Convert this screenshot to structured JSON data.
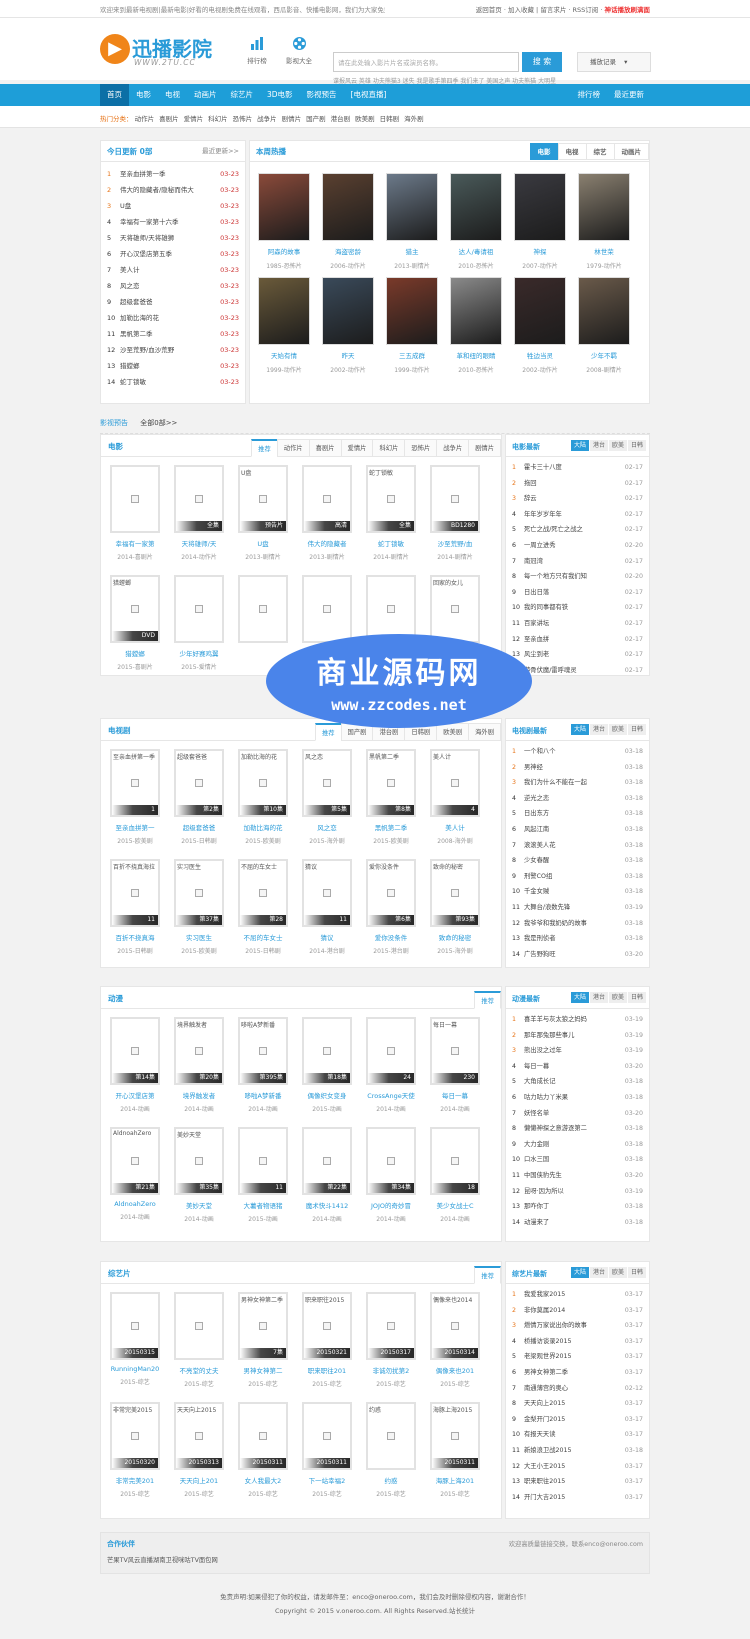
{
  "topbar": {
    "text": "欢迎来到最新电视剧|最新电影|好看的电视剧免费在线观看，西瓜影音、快播电影网，我们为大家免费提供好看的电影",
    "links": [
      "返回首页",
      "加入收藏",
      "留言求片",
      "RSS订阅"
    ],
    "hot": "神话播放刷满面"
  },
  "header": {
    "logo_name": "迅播影院",
    "logo_domain": "WWW.2TU.CC",
    "icons": [
      {
        "label": "排行榜",
        "icon": "bar-chart-icon"
      },
      {
        "label": "影视大全",
        "icon": "film-reel-icon"
      }
    ],
    "search_placeholder": "请在此处输入影片片名或演员名称。",
    "search_button": "搜 索",
    "hotwords": "谍报风云  英雄  功夫熊猫3  迷失  我是歌手第四季  我们来了  美国之声  功夫熊猫  大明星",
    "history": "播放记录"
  },
  "nav": {
    "items": [
      "首页",
      "电影",
      "电视",
      "动画片",
      "综艺片",
      "3D电影",
      "影视预告",
      "[电视直播]"
    ],
    "right": [
      "排行榜",
      "最近更新"
    ]
  },
  "subnav": {
    "label": "热门分类：",
    "items": [
      "动作片",
      "喜剧片",
      "爱情片",
      "科幻片",
      "恐怖片",
      "战争片",
      "剧情片",
      "国产剧",
      "港台剧",
      "欧美剧",
      "日韩剧",
      "海外剧"
    ]
  },
  "today": {
    "title": "今日更新 0部",
    "more": "最近更新>>",
    "items": [
      {
        "n": "1",
        "t": "至亲血拼第一季",
        "d": "03-23"
      },
      {
        "n": "2",
        "t": "伟大的隐藏者/隐秘而伟大",
        "d": "03-23"
      },
      {
        "n": "3",
        "t": "U盘",
        "d": "03-23"
      },
      {
        "n": "4",
        "t": "幸福有一家第十六季",
        "d": "03-23"
      },
      {
        "n": "5",
        "t": "天将雄师/天将雄狮",
        "d": "03-23"
      },
      {
        "n": "6",
        "t": "开心汉堡店第五季",
        "d": "03-23"
      },
      {
        "n": "7",
        "t": "美人计",
        "d": "03-23"
      },
      {
        "n": "8",
        "t": "风之恋",
        "d": "03-23"
      },
      {
        "n": "9",
        "t": "超级套爸爸",
        "d": "03-23"
      },
      {
        "n": "10",
        "t": "加勒比海的花",
        "d": "03-23"
      },
      {
        "n": "11",
        "t": "黑帆第二季",
        "d": "03-23"
      },
      {
        "n": "12",
        "t": "沙至荒野/血沙荒野",
        "d": "03-23"
      },
      {
        "n": "13",
        "t": "猎螳螂",
        "d": "03-23"
      },
      {
        "n": "14",
        "t": "蛇丁锁敏",
        "d": "03-23"
      }
    ]
  },
  "hotweek": {
    "title": "本周热播",
    "tabs": [
      "电影",
      "电视",
      "综艺",
      "动画片"
    ],
    "row1": [
      {
        "nm": "阿森的故事",
        "sb": "1985-恐怖片",
        "c": "#8a4a3a"
      },
      {
        "nm": "海盗密龄",
        "sb": "2006-动作片",
        "c": "#5a4030"
      },
      {
        "nm": "猎主",
        "sb": "2013-剧情片",
        "c": "#6c7a8a"
      },
      {
        "nm": "达人/毒请祖",
        "sb": "2010-恐怖片",
        "c": "#4a5a5a"
      },
      {
        "nm": "神探",
        "sb": "2007-动作片",
        "c": "#3a3a40"
      },
      {
        "nm": "林世荣",
        "sb": "1979-动作片",
        "c": "#8a8070"
      }
    ],
    "row2": [
      {
        "nm": "天始有情",
        "sb": "1999-动作片",
        "c": "#6a5a3a"
      },
      {
        "nm": "昨天",
        "sb": "2002-动作片",
        "c": "#3a4a5a"
      },
      {
        "nm": "三五成群",
        "sb": "1999-动作片",
        "c": "#7a3a2a"
      },
      {
        "nm": "革和纽的眼睛",
        "sb": "2010-恐怖片",
        "c": "#8a8a8a"
      },
      {
        "nm": "牲边当灵",
        "sb": "2002-动作片",
        "c": "#3a2a2a"
      },
      {
        "nm": "少年不羁",
        "sb": "2008-剧情片",
        "c": "#6a5a4a"
      }
    ]
  },
  "preview": {
    "title": "影视预告",
    "all": "全部0部>>"
  },
  "movies": {
    "title": "电影",
    "tabs": [
      "推荐",
      "动作片",
      "喜剧片",
      "爱情片",
      "科幻片",
      "恐怖片",
      "战争片",
      "剧情片"
    ],
    "row1": [
      {
        "cap": "",
        "bar": "",
        "nm": "幸福有一家第",
        "sb": "2014-喜剧片"
      },
      {
        "cap": "",
        "bar": "全集",
        "nm": "天将雄师/天",
        "sb": "2014-动作片"
      },
      {
        "cap": "U盘",
        "bar": "预告片",
        "nm": "U盘",
        "sb": "2013-剧情片"
      },
      {
        "cap": "",
        "bar": "高清",
        "nm": "伟大的隐藏者",
        "sb": "2013-剧情片"
      },
      {
        "cap": "蛇丁锁敏",
        "bar": "全集",
        "nm": "蛇丁锁敏",
        "sb": "2014-剧情片"
      },
      {
        "cap": "",
        "bar": "BD1280",
        "nm": "沙至荒野/血",
        "sb": "2014-剧情片"
      }
    ],
    "row2": [
      {
        "cap": "猎螳螂",
        "bar": "DVD",
        "nm": "猎螳螂",
        "sb": "2015-喜剧片"
      },
      {
        "cap": "",
        "bar": "",
        "nm": "少年好赛鸡翼",
        "sb": "2015-爱情片"
      },
      {
        "cap": "",
        "bar": "",
        "nm": "",
        "sb": ""
      },
      {
        "cap": "",
        "bar": "",
        "nm": "",
        "sb": ""
      },
      {
        "cap": "",
        "bar": "",
        "nm": "",
        "sb": ""
      },
      {
        "cap": "回家的女儿",
        "bar": "",
        "nm": "",
        "sb": ""
      }
    ]
  },
  "movie_rank": {
    "title": "电影最新",
    "tabs": [
      "大陆",
      "港台",
      "欧美",
      "日韩"
    ],
    "items": [
      {
        "n": "1",
        "t": "霍卡三十八度",
        "d": "02-17"
      },
      {
        "n": "2",
        "t": "拖回",
        "d": "02-17"
      },
      {
        "n": "3",
        "t": "辞云",
        "d": "02-17"
      },
      {
        "n": "4",
        "t": "年年岁岁年年",
        "d": "02-17"
      },
      {
        "n": "5",
        "t": "死亡之战/死亡之战之",
        "d": "02-17"
      },
      {
        "n": "6",
        "t": "一周立进秀",
        "d": "02-20"
      },
      {
        "n": "7",
        "t": "南冠湾",
        "d": "02-17"
      },
      {
        "n": "8",
        "t": "每一个地方只有我们知",
        "d": "02-20"
      },
      {
        "n": "9",
        "t": "日出日落",
        "d": "02-17"
      },
      {
        "n": "10",
        "t": "我的同事都有铁",
        "d": "02-17"
      },
      {
        "n": "11",
        "t": "百家讲坛",
        "d": "02-17"
      },
      {
        "n": "12",
        "t": "至亲血拼",
        "d": "02-17"
      },
      {
        "n": "13",
        "t": "风尘到老",
        "d": "02-17"
      },
      {
        "n": "14",
        "t": "游骨伏魔/雷呼魂灵",
        "d": "02-17"
      }
    ]
  },
  "tv": {
    "title": "电视剧",
    "tabs": [
      "推荐",
      "国产剧",
      "港台剧",
      "日韩剧",
      "欧美剧",
      "海外剧"
    ],
    "row1": [
      {
        "cap": "至亲血拼第一季",
        "bar": "1",
        "nm": "至亲血拼第一",
        "sb": "2015-欧美剧"
      },
      {
        "cap": "超级套爸爸",
        "bar": "第2集",
        "nm": "超级套爸爸",
        "sb": "2015-日韩剧"
      },
      {
        "cap": "加勒比海的花",
        "bar": "第10集",
        "nm": "加勒比海的花",
        "sb": "2015-欧美剧"
      },
      {
        "cap": "风之恋",
        "bar": "第5集",
        "nm": "风之恋",
        "sb": "2015-海外剧"
      },
      {
        "cap": "黑帆第二季",
        "bar": "第8集",
        "nm": "黑帆第二季",
        "sb": "2015-欧美剧"
      },
      {
        "cap": "美人计",
        "bar": "4",
        "nm": "美人计",
        "sb": "2008-海外剧"
      }
    ],
    "row2": [
      {
        "cap": "百折不挠真海拉",
        "bar": "11",
        "nm": "百折不挠真海",
        "sb": "2015-日韩剧"
      },
      {
        "cap": "实习医生",
        "bar": "第37集",
        "nm": "实习医生",
        "sb": "2015-欧美剧"
      },
      {
        "cap": "不屈的车女士",
        "bar": "第28",
        "nm": "不屈的车女士",
        "sb": "2015-日韩剧"
      },
      {
        "cap": "猜议",
        "bar": "11",
        "nm": "猜议",
        "sb": "2014-港台剧"
      },
      {
        "cap": "爱你没条件",
        "bar": "第6集",
        "nm": "爱你没条件",
        "sb": "2015-港台剧"
      },
      {
        "cap": "致命的秘密",
        "bar": "第93集",
        "nm": "致命的秘密",
        "sb": "2015-海外剧"
      }
    ]
  },
  "tv_rank": {
    "title": "电视剧最新",
    "tabs": [
      "大陆",
      "港台",
      "欧美",
      "日韩"
    ],
    "items": [
      {
        "n": "1",
        "t": "一个和八个",
        "d": "03-18"
      },
      {
        "n": "2",
        "t": "男神经",
        "d": "03-18"
      },
      {
        "n": "3",
        "t": "我们为什么不能在一起",
        "d": "03-18"
      },
      {
        "n": "4",
        "t": "逆光之恋",
        "d": "03-18"
      },
      {
        "n": "5",
        "t": "日出东方",
        "d": "03-18"
      },
      {
        "n": "6",
        "t": "风起江南",
        "d": "03-18"
      },
      {
        "n": "7",
        "t": "滚滚美人花",
        "d": "03-18"
      },
      {
        "n": "8",
        "t": "少女春醒",
        "d": "03-18"
      },
      {
        "n": "9",
        "t": "刑警CO组",
        "d": "03-18"
      },
      {
        "n": "10",
        "t": "千金女贼",
        "d": "03-18"
      },
      {
        "n": "11",
        "t": "大舞台/浪数先锋",
        "d": "03-19"
      },
      {
        "n": "12",
        "t": "我爷爷和我奶奶的故事",
        "d": "03-18"
      },
      {
        "n": "13",
        "t": "我是刑侦者",
        "d": "03-18"
      },
      {
        "n": "14",
        "t": "广告野狗旺",
        "d": "03-20"
      }
    ]
  },
  "anime": {
    "title": "动漫",
    "tabs": [
      "推荐"
    ],
    "row1": [
      {
        "cap": "",
        "bar": "第14集",
        "nm": "开心汉堡店第",
        "sb": "2014-动画"
      },
      {
        "cap": "境界触发者",
        "bar": "第20集",
        "nm": "境界触发者",
        "sb": "2014-动画"
      },
      {
        "cap": "哆啦A梦新番",
        "bar": "第395集",
        "nm": "哆啦A梦新番",
        "sb": "2014-动画"
      },
      {
        "cap": "",
        "bar": "第18集",
        "nm": "偶像织女变身",
        "sb": "2015-动画"
      },
      {
        "cap": "",
        "bar": "24",
        "nm": "CrossAnge天使",
        "sb": "2014-动画"
      },
      {
        "cap": "每日一幕",
        "bar": "230",
        "nm": "每日一幕",
        "sb": "2014-动画"
      }
    ],
    "row2": [
      {
        "cap": "AldnoahZero",
        "bar": "第21集",
        "nm": "AldnoahZero",
        "sb": "2014-动画"
      },
      {
        "cap": "美妙天堂",
        "bar": "第35集",
        "nm": "美妙天堂",
        "sb": "2014-动画"
      },
      {
        "cap": "",
        "bar": "11",
        "nm": "大薯者物语猪",
        "sb": "2015-动画"
      },
      {
        "cap": "",
        "bar": "第22集",
        "nm": "魔术快斗1412",
        "sb": "2014-动画"
      },
      {
        "cap": "",
        "bar": "第34集",
        "nm": "JOJO的奇妙冒",
        "sb": "2014-动画"
      },
      {
        "cap": "",
        "bar": "18",
        "nm": "美少女战士C",
        "sb": "2014-动画"
      }
    ]
  },
  "anime_rank": {
    "title": "动漫最新",
    "tabs": [
      "大陆",
      "港台",
      "欧美",
      "日韩"
    ],
    "items": [
      {
        "n": "1",
        "t": "喜羊羊与灰太狼之妈妈",
        "d": "03-19"
      },
      {
        "n": "2",
        "t": "那年那兔那些事儿",
        "d": "03-19"
      },
      {
        "n": "3",
        "t": "熊出没之过年",
        "d": "03-19"
      },
      {
        "n": "4",
        "t": "每日一幕",
        "d": "03-20"
      },
      {
        "n": "5",
        "t": "大角成长记",
        "d": "03-18"
      },
      {
        "n": "6",
        "t": "咕力咕力丫米果",
        "d": "03-18"
      },
      {
        "n": "7",
        "t": "妖怪名单",
        "d": "03-20"
      },
      {
        "n": "8",
        "t": "懒懒神探之意游逐第二",
        "d": "03-18"
      },
      {
        "n": "9",
        "t": "大力金刚",
        "d": "03-18"
      },
      {
        "n": "10",
        "t": "口水三国",
        "d": "03-18"
      },
      {
        "n": "11",
        "t": "中国侠豹先生",
        "d": "03-20"
      },
      {
        "n": "12",
        "t": "昆呀·因为所以",
        "d": "03-19"
      },
      {
        "n": "13",
        "t": "那咋你丁",
        "d": "03-18"
      },
      {
        "n": "14",
        "t": "动漫来了",
        "d": "03-18"
      }
    ]
  },
  "variety": {
    "title": "综艺片",
    "tabs": [
      "推荐"
    ],
    "row1": [
      {
        "cap": "",
        "bar": "20150315",
        "nm": "RunningMan20",
        "sb": "2015-综艺"
      },
      {
        "cap": "",
        "bar": "",
        "nm": "不亮堂的丈夫",
        "sb": "2015-综艺"
      },
      {
        "cap": "男神女神第二季",
        "bar": "7集",
        "nm": "男神女神第二",
        "sb": "2015-综艺"
      },
      {
        "cap": "职来职往2015",
        "bar": "20150321",
        "nm": "职来职往201",
        "sb": "2015-综艺"
      },
      {
        "cap": "",
        "bar": "20150317",
        "nm": "非诚勿扰第2",
        "sb": "2015-综艺"
      },
      {
        "cap": "偶像来也2014",
        "bar": "20150314",
        "nm": "偶像来也201",
        "sb": "2015-综艺"
      }
    ],
    "row2": [
      {
        "cap": "非常完美2015",
        "bar": "20150320",
        "nm": "非常完美201",
        "sb": "2015-综艺"
      },
      {
        "cap": "天天向上2015",
        "bar": "20150313",
        "nm": "天天向上201",
        "sb": "2015-综艺"
      },
      {
        "cap": "",
        "bar": "20150311",
        "nm": "女人我最大2",
        "sb": "2015-综艺"
      },
      {
        "cap": "",
        "bar": "20150311",
        "nm": "下一站幸福2",
        "sb": "2015-综艺"
      },
      {
        "cap": "约惑",
        "bar": "",
        "nm": "约惑",
        "sb": "2015-综艺"
      },
      {
        "cap": "海豚上海2015",
        "bar": "20150311",
        "nm": "海豚上海201",
        "sb": "2015-综艺"
      }
    ]
  },
  "variety_rank": {
    "title": "综艺片最新",
    "tabs": [
      "大陆",
      "港台",
      "欧美",
      "日韩"
    ],
    "items": [
      {
        "n": "1",
        "t": "我爱我家2015",
        "d": "03-17"
      },
      {
        "n": "2",
        "t": "非你莫属2014",
        "d": "03-17"
      },
      {
        "n": "3",
        "t": "燃情万家说出你的故事",
        "d": "03-17"
      },
      {
        "n": "4",
        "t": "桥播访谈录2015",
        "d": "03-17"
      },
      {
        "n": "5",
        "t": "老梁观世界2015",
        "d": "03-17"
      },
      {
        "n": "6",
        "t": "男神女神第二季",
        "d": "03-17"
      },
      {
        "n": "7",
        "t": "南通薄宫的奥心",
        "d": "02-12"
      },
      {
        "n": "8",
        "t": "天天向上2015",
        "d": "03-17"
      },
      {
        "n": "9",
        "t": "金梨开门2015",
        "d": "03-17"
      },
      {
        "n": "10",
        "t": "有报天天读",
        "d": "03-17"
      },
      {
        "n": "11",
        "t": "新娘浪卫战2015",
        "d": "03-18"
      },
      {
        "n": "12",
        "t": "大王小王2015",
        "d": "03-17"
      },
      {
        "n": "13",
        "t": "职来职往2015",
        "d": "03-17"
      },
      {
        "n": "14",
        "t": "开门大吉2015",
        "d": "03-17"
      }
    ]
  },
  "partners": {
    "title": "合作伙伴",
    "contact": "欢迎高质量链接交换，联系enco@oneroo.com",
    "links": "芒果TV风云直播湖南卫视咪咕TV面包网"
  },
  "footer": {
    "line1": "免责声明:如果侵犯了你的权益，请发邮件至：enco@oneroo.com，我们会及时删除侵权内容，谢谢合作！",
    "line2": "Copyright © 2015 v.oneroo.com. All Rights Reserved.站长统计"
  },
  "watermark": {
    "main": "商业源码网",
    "url": "www.zzcodes.net"
  }
}
